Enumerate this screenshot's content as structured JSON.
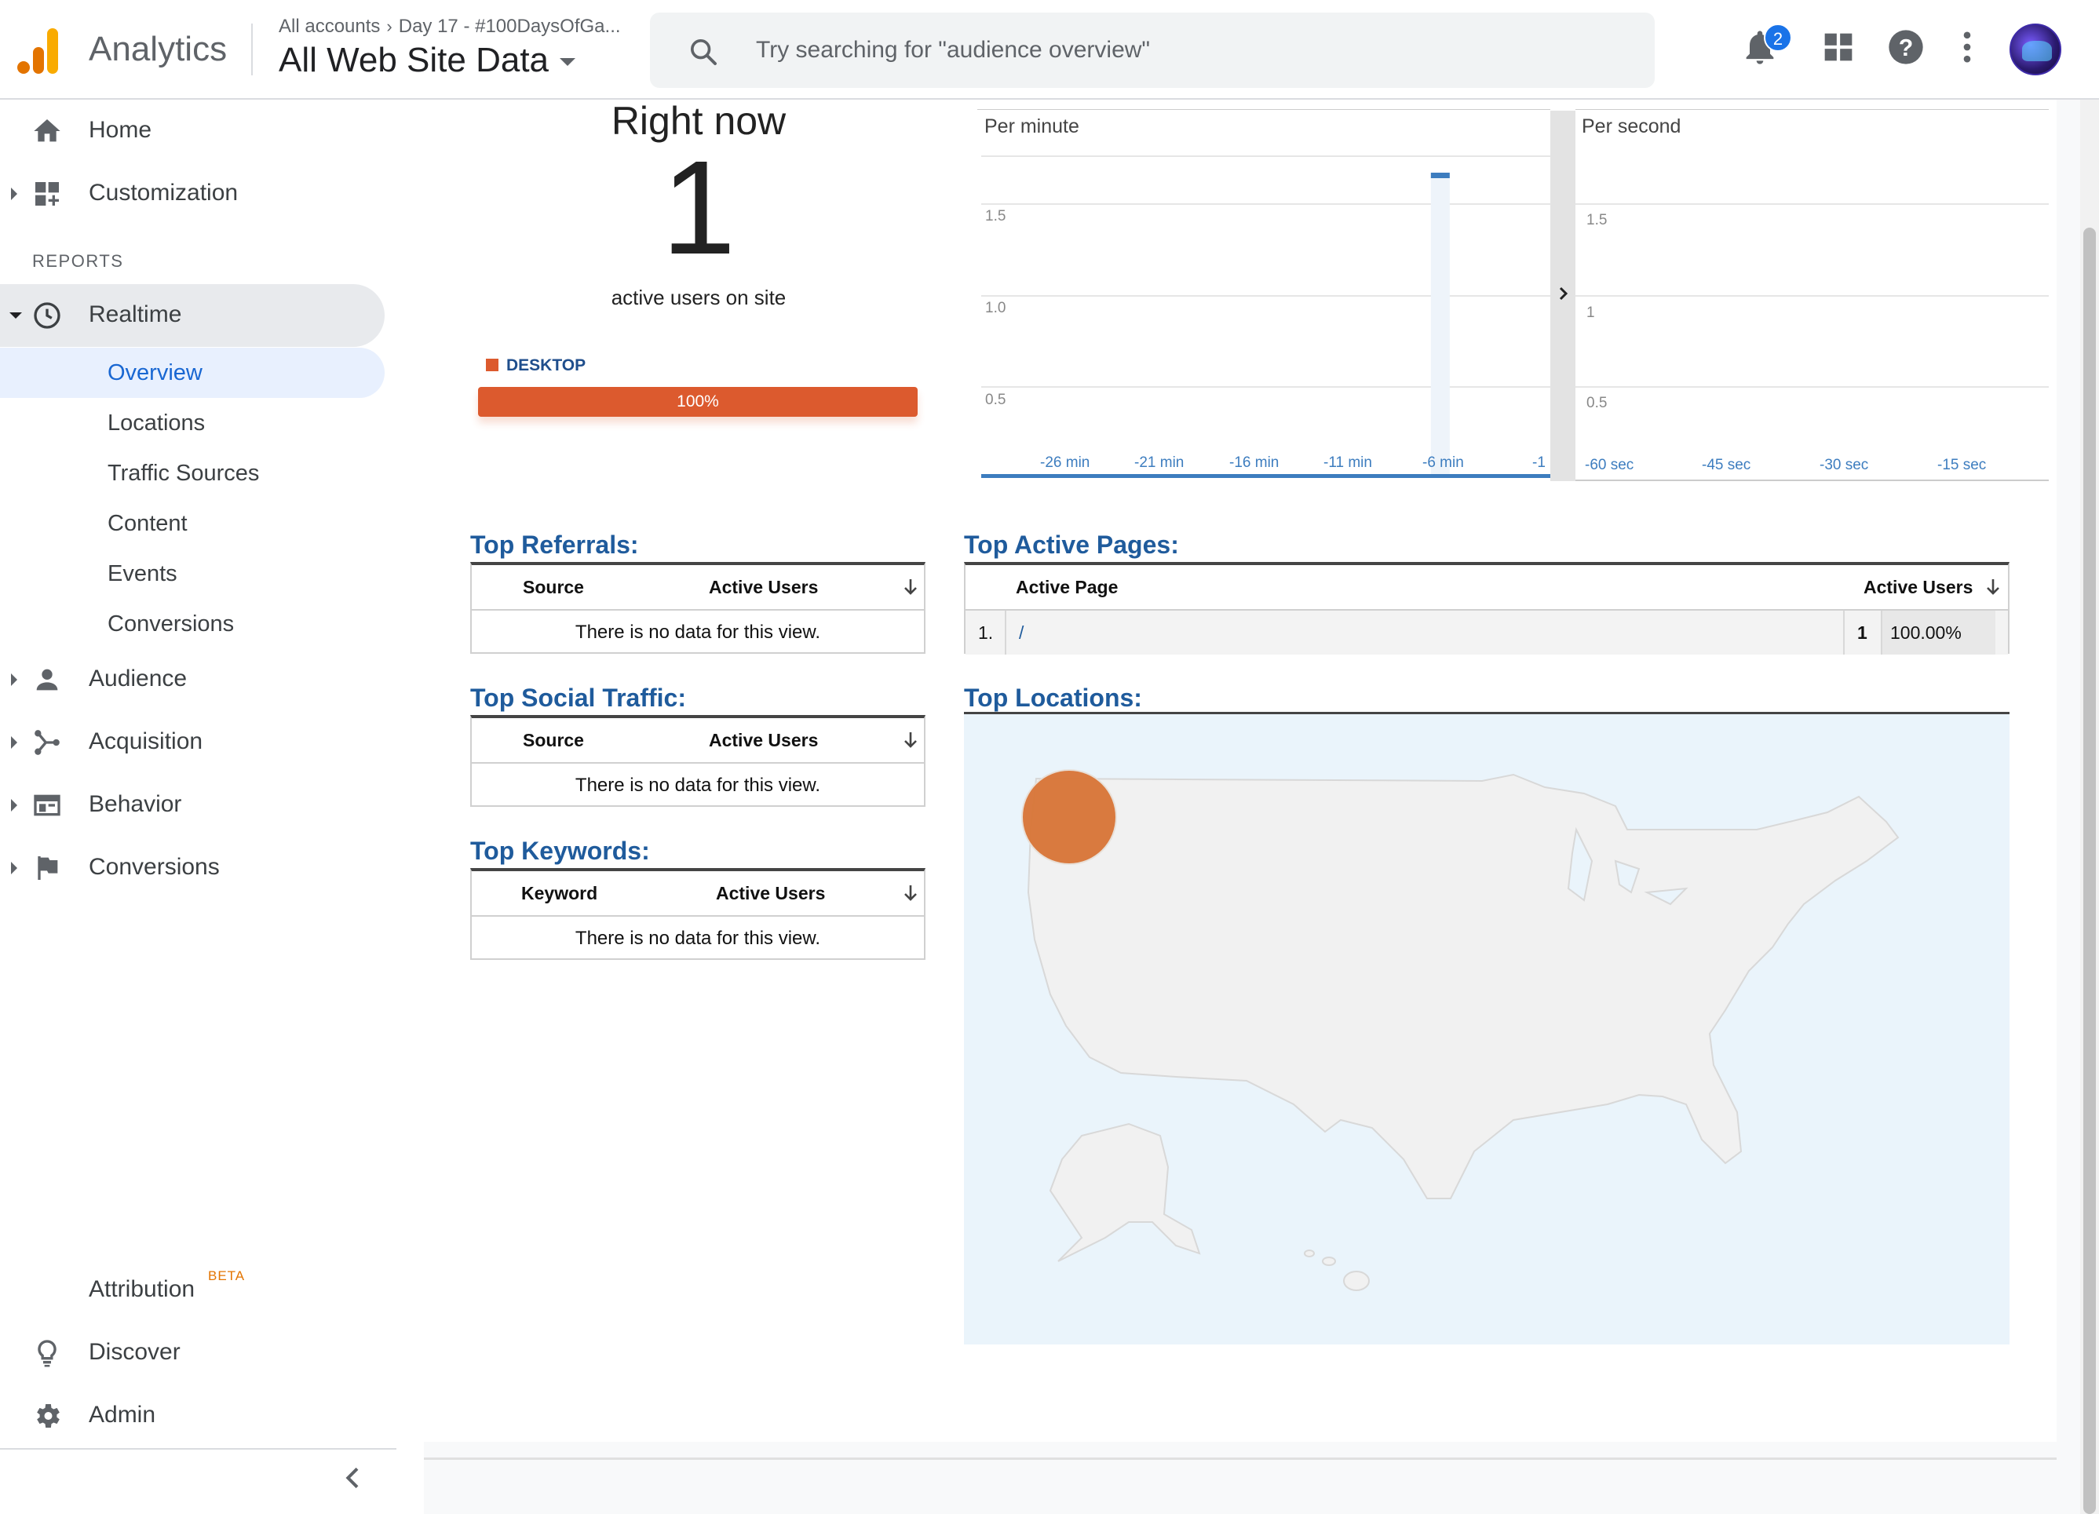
{
  "header": {
    "app_name": "Analytics",
    "breadcrumb_root": "All accounts",
    "breadcrumb_property": "Day 17 - #100DaysOfGa...",
    "view_name": "All Web Site Data",
    "search_placeholder": "Try searching for \"audience overview\"",
    "notification_count": "2",
    "icons": [
      "search-icon",
      "bell-icon",
      "apps-grid-icon",
      "help-icon",
      "more-vert-icon"
    ]
  },
  "sidebar": {
    "home": "Home",
    "customization": "Customization",
    "reports_label": "REPORTS",
    "realtime": "Realtime",
    "realtime_items": [
      "Overview",
      "Locations",
      "Traffic Sources",
      "Content",
      "Events",
      "Conversions"
    ],
    "audience": "Audience",
    "acquisition": "Acquisition",
    "behavior": "Behavior",
    "conversions": "Conversions",
    "attribution": "Attribution",
    "attribution_badge": "BETA",
    "discover": "Discover",
    "admin": "Admin"
  },
  "right_now": {
    "title": "Right now",
    "count": "1",
    "subtitle": "active users on site",
    "device_label": "DESKTOP",
    "device_percent_label": "100%",
    "device_share": 1.0,
    "device_color": "#dc5a2e"
  },
  "pageviews_chart": {
    "per_minute_label": "Per minute",
    "per_second_label": "Per second",
    "per_minute_y_ticks": [
      "1.5",
      "1.0",
      "0.5"
    ],
    "per_second_y_ticks": [
      "1.5",
      "1",
      "0.5"
    ],
    "per_minute_x_ticks": [
      "-26 min",
      "-21 min",
      "-16 min",
      "-11 min",
      "-6 min",
      "-1"
    ],
    "per_second_x_ticks": [
      "-60 sec",
      "-45 sec",
      "-30 sec",
      "-15 sec"
    ]
  },
  "chart_data": [
    {
      "type": "bar",
      "title": "Per minute",
      "x": [
        -30,
        -29,
        -28,
        -27,
        -26,
        -25,
        -24,
        -23,
        -22,
        -21,
        -20,
        -19,
        -18,
        -17,
        -16,
        -15,
        -14,
        -13,
        -12,
        -11,
        -10,
        -9,
        -8,
        -7,
        -6,
        -5,
        -4,
        -3,
        -2,
        -1
      ],
      "values": [
        0,
        0,
        0,
        0,
        0,
        0,
        0,
        0,
        0,
        0,
        0,
        0,
        0,
        0,
        0,
        0,
        0,
        0,
        0,
        0,
        0,
        0,
        0,
        0,
        1,
        0,
        0,
        0,
        0,
        0
      ],
      "ylim": [
        0,
        2
      ],
      "bar_color": "#3d7dbf"
    },
    {
      "type": "bar",
      "title": "Per second",
      "x": [
        -60,
        -45,
        -30,
        -15
      ],
      "values": [
        0,
        0,
        0,
        0
      ],
      "ylim": [
        0,
        2
      ]
    }
  ],
  "top_referrals": {
    "title": "Top Referrals:",
    "col_source": "Source",
    "col_users": "Active Users",
    "empty": "There is no data for this view."
  },
  "top_social": {
    "title": "Top Social Traffic:",
    "col_source": "Source",
    "col_users": "Active Users",
    "empty": "There is no data for this view."
  },
  "top_keywords": {
    "title": "Top Keywords:",
    "col_keyword": "Keyword",
    "col_users": "Active Users",
    "empty": "There is no data for this view."
  },
  "top_active_pages": {
    "title": "Top Active Pages:",
    "col_page": "Active Page",
    "col_users": "Active Users",
    "rows": [
      {
        "rank": "1.",
        "page": "/",
        "users": "1",
        "percent": "100.00%"
      }
    ]
  },
  "top_locations": {
    "title": "Top Locations:",
    "marker_color": "#d9773a"
  }
}
